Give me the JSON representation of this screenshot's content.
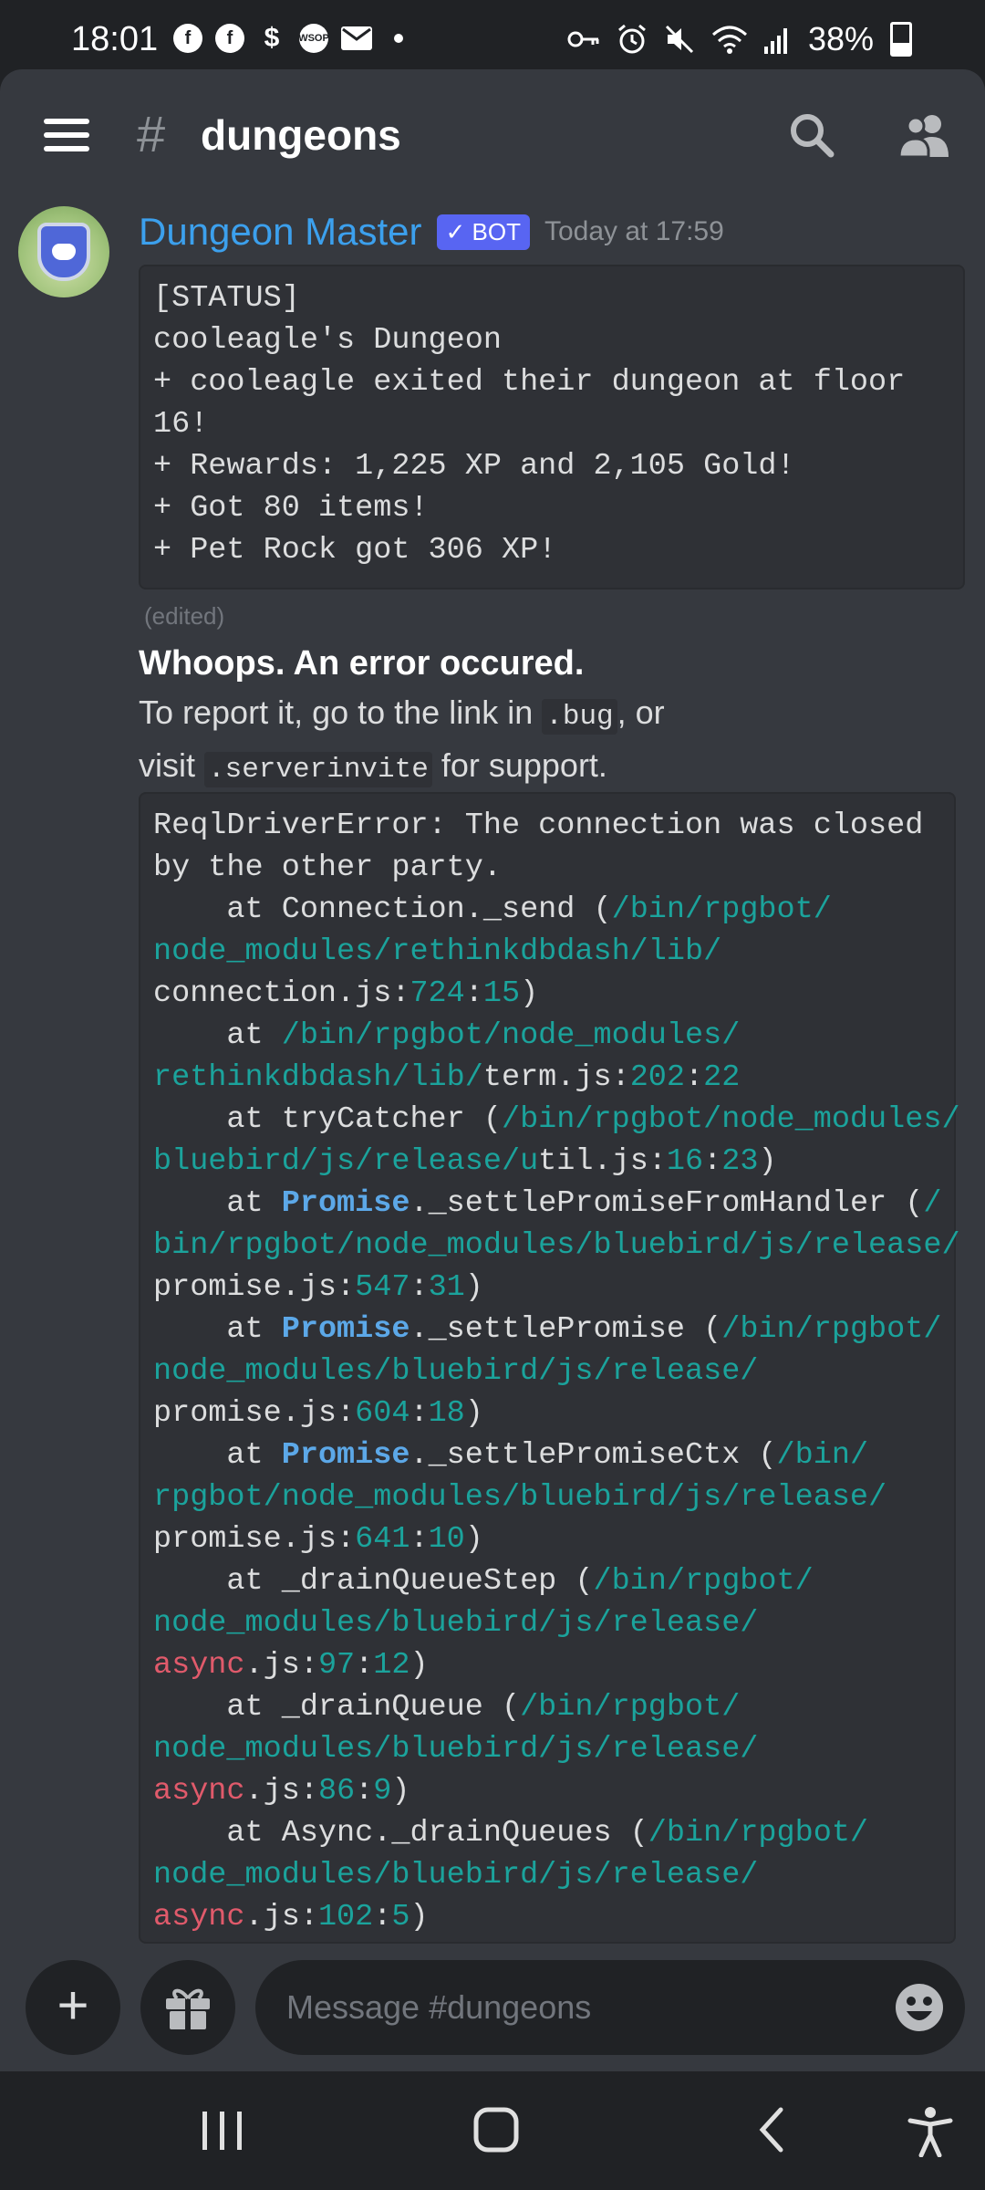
{
  "status_bar": {
    "time": "18:01",
    "notification_icons": [
      "facebook-icon",
      "facebook-icon",
      "dollar-icon",
      "wsop-icon",
      "mail-icon"
    ],
    "right_icons": [
      "key-icon",
      "alarm-icon",
      "mute-icon",
      "wifi-icon",
      "signal-icon"
    ],
    "battery_percent": "38%",
    "battery_level": 0.38
  },
  "header": {
    "hash": "#",
    "channel": "dungeons"
  },
  "message": {
    "author": "Dungeon Master",
    "badge": "✓ BOT",
    "timestamp": "Today at 17:59",
    "status_lines": [
      "[STATUS]",
      "cooleagle's Dungeon",
      "+ cooleagle exited their dungeon at floor",
      "16!",
      "+ Rewards: 1,225 XP and 2,105 Gold!",
      "+ Got 80 items!",
      "+ Pet Rock got 306 XP!"
    ],
    "edited": "(edited)",
    "error_title": "Whoops. An error occured.",
    "error_line1_prefix": "To report it, go to the link in ",
    "error_line1_code": ".bug",
    "error_line1_suffix": ", or",
    "error_line2_prefix": "visit ",
    "error_line2_code": ".serverinvite",
    "error_line2_suffix": " for support.",
    "trace_lines": [
      [
        {
          "t": "ReqlDriverError: The connection was closed",
          "c": "w"
        }
      ],
      [
        {
          "t": "by the other party.",
          "c": "w"
        }
      ],
      [
        {
          "t": "    at Connection._send (",
          "c": "w"
        },
        {
          "t": "/bin/rpgbot/",
          "c": "p"
        }
      ],
      [
        {
          "t": "node_modules/rethinkdbdash/lib/",
          "c": "p"
        }
      ],
      [
        {
          "t": "connection.js:",
          "c": "w"
        },
        {
          "t": "724",
          "c": "n"
        },
        {
          "t": ":",
          "c": "w"
        },
        {
          "t": "15",
          "c": "n"
        },
        {
          "t": ")",
          "c": "w"
        }
      ],
      [
        {
          "t": "    at ",
          "c": "w"
        },
        {
          "t": "/bin/rpgbot/node_modules/",
          "c": "p"
        }
      ],
      [
        {
          "t": "rethinkdbdash/lib/",
          "c": "p"
        },
        {
          "t": "term.js:",
          "c": "w"
        },
        {
          "t": "202",
          "c": "n"
        },
        {
          "t": ":",
          "c": "w"
        },
        {
          "t": "22",
          "c": "n"
        }
      ],
      [
        {
          "t": "    at tryCatcher (",
          "c": "w"
        },
        {
          "t": "/bin/rpgbot/node_modules/",
          "c": "p"
        }
      ],
      [
        {
          "t": "bluebird/js/release/u",
          "c": "p"
        },
        {
          "t": "til.js:",
          "c": "w"
        },
        {
          "t": "16",
          "c": "n"
        },
        {
          "t": ":",
          "c": "w"
        },
        {
          "t": "23",
          "c": "n"
        },
        {
          "t": ")",
          "c": "w"
        }
      ],
      [
        {
          "t": "    at ",
          "c": "w"
        },
        {
          "t": "Promise",
          "c": "b"
        },
        {
          "t": "._settlePromiseFromHandler (",
          "c": "w"
        },
        {
          "t": "/",
          "c": "p"
        }
      ],
      [
        {
          "t": "bin/rpgbot/node_modules/bluebird/js/release/",
          "c": "p"
        }
      ],
      [
        {
          "t": "promise.js:",
          "c": "w"
        },
        {
          "t": "547",
          "c": "n"
        },
        {
          "t": ":",
          "c": "w"
        },
        {
          "t": "31",
          "c": "n"
        },
        {
          "t": ")",
          "c": "w"
        }
      ],
      [
        {
          "t": "    at ",
          "c": "w"
        },
        {
          "t": "Promise",
          "c": "b"
        },
        {
          "t": "._settlePromise (",
          "c": "w"
        },
        {
          "t": "/bin/rpgbot/",
          "c": "p"
        }
      ],
      [
        {
          "t": "node_modules/bluebird/js/release/",
          "c": "p"
        }
      ],
      [
        {
          "t": "promise.js:",
          "c": "w"
        },
        {
          "t": "604",
          "c": "n"
        },
        {
          "t": ":",
          "c": "w"
        },
        {
          "t": "18",
          "c": "n"
        },
        {
          "t": ")",
          "c": "w"
        }
      ],
      [
        {
          "t": "    at ",
          "c": "w"
        },
        {
          "t": "Promise",
          "c": "b"
        },
        {
          "t": "._settlePromiseCtx (",
          "c": "w"
        },
        {
          "t": "/bin/",
          "c": "p"
        }
      ],
      [
        {
          "t": "rpgbot/node_modules/bluebird/js/release/",
          "c": "p"
        }
      ],
      [
        {
          "t": "promise.js:",
          "c": "w"
        },
        {
          "t": "641",
          "c": "n"
        },
        {
          "t": ":",
          "c": "w"
        },
        {
          "t": "10",
          "c": "n"
        },
        {
          "t": ")",
          "c": "w"
        }
      ],
      [
        {
          "t": "    at _drainQueueStep (",
          "c": "w"
        },
        {
          "t": "/bin/rpgbot/",
          "c": "p"
        }
      ],
      [
        {
          "t": "node_modules/bluebird/js/release/",
          "c": "p"
        }
      ],
      [
        {
          "t": "async",
          "c": "r"
        },
        {
          "t": ".js:",
          "c": "w"
        },
        {
          "t": "97",
          "c": "n"
        },
        {
          "t": ":",
          "c": "w"
        },
        {
          "t": "12",
          "c": "n"
        },
        {
          "t": ")",
          "c": "w"
        }
      ],
      [
        {
          "t": "    at _drainQueue (",
          "c": "w"
        },
        {
          "t": "/bin/rpgbot/",
          "c": "p"
        }
      ],
      [
        {
          "t": "node_modules/bluebird/js/release/",
          "c": "p"
        }
      ],
      [
        {
          "t": "async",
          "c": "r"
        },
        {
          "t": ".js:",
          "c": "w"
        },
        {
          "t": "86",
          "c": "n"
        },
        {
          "t": ":",
          "c": "w"
        },
        {
          "t": "9",
          "c": "n"
        },
        {
          "t": ")",
          "c": "w"
        }
      ],
      [
        {
          "t": "    at Async._drainQueues (",
          "c": "w"
        },
        {
          "t": "/bin/rpgbot/",
          "c": "p"
        }
      ],
      [
        {
          "t": "node_modules/bluebird/js/release/",
          "c": "p"
        }
      ],
      [
        {
          "t": "async",
          "c": "r"
        },
        {
          "t": ".js:",
          "c": "w"
        },
        {
          "t": "102",
          "c": "n"
        },
        {
          "t": ":",
          "c": "w"
        },
        {
          "t": "5",
          "c": "n"
        },
        {
          "t": ")",
          "c": "w"
        }
      ]
    ]
  },
  "input": {
    "placeholder": "Message #dungeons",
    "plus_icon": "plus-icon",
    "gift_icon": "gift-icon",
    "emoji_icon": "emoji-icon"
  },
  "navbar": {
    "icons": [
      "recent-apps-icon",
      "home-icon",
      "back-icon",
      "accessibility-icon"
    ]
  },
  "colors": {
    "background": "#36393f",
    "dark": "#202225",
    "username": "#3ca0ed",
    "bot_badge": "#5865f2",
    "path": "#1ba39c",
    "keyword": "#5ca8e8",
    "async": "#e05a6b"
  }
}
